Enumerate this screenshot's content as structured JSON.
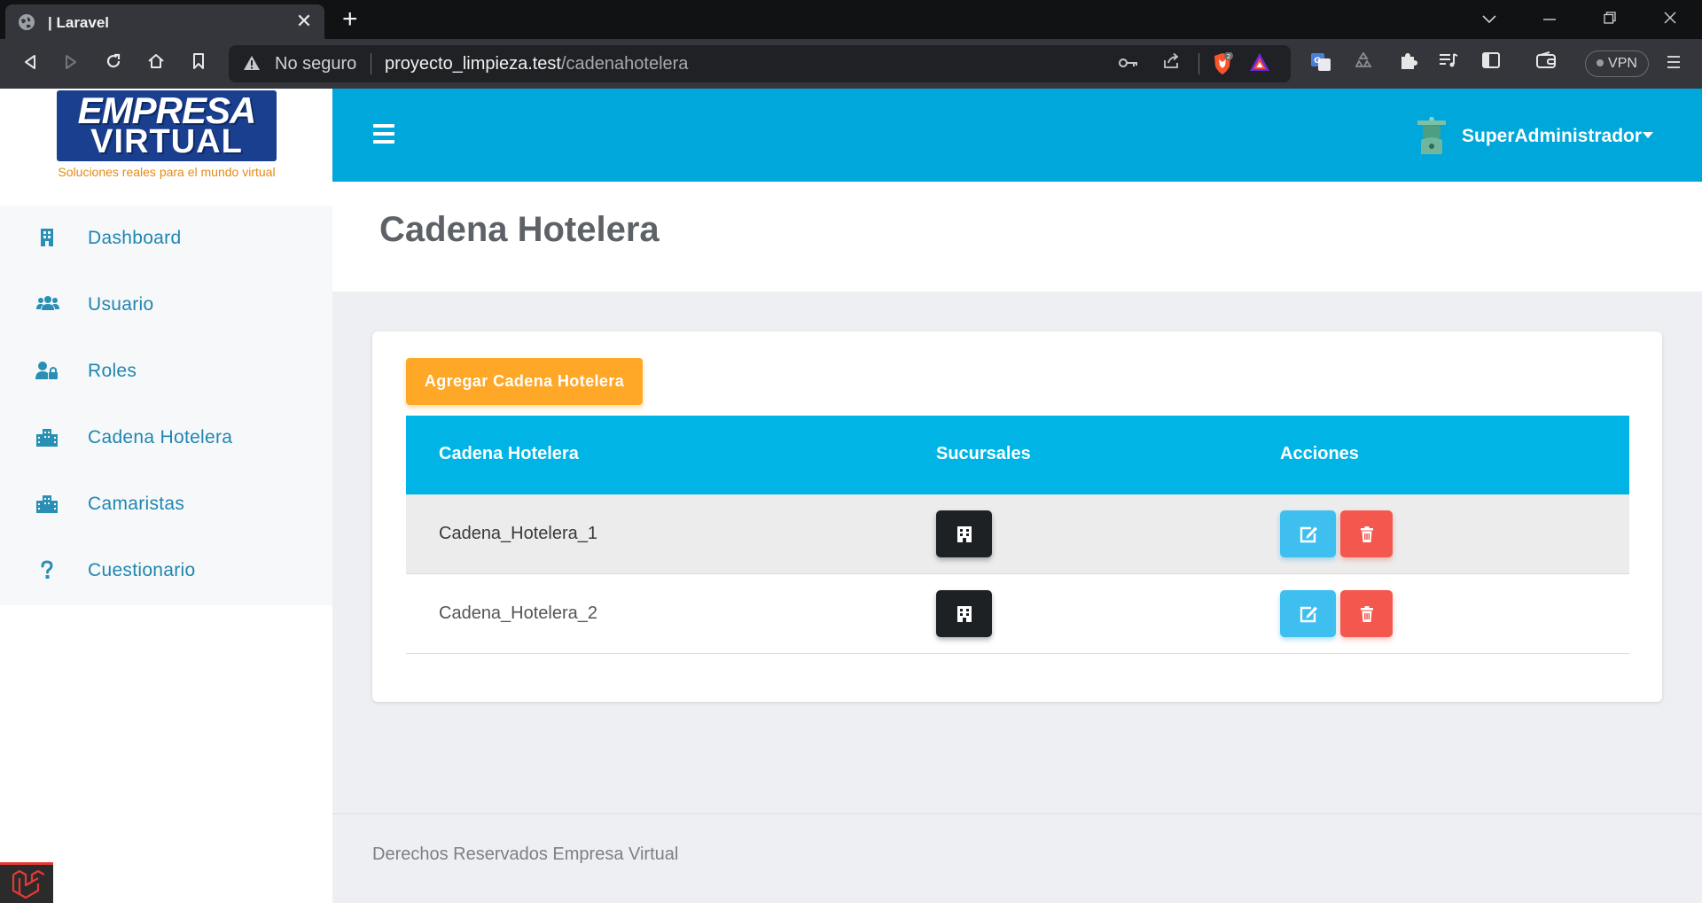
{
  "browser": {
    "tab_title": "| Laravel",
    "tab_close": "✕",
    "new_tab": "+",
    "security_label": "No seguro",
    "url_host": "proyecto_limpieza.test",
    "url_path": "/cadenahotelera",
    "brave_badge_count": "2",
    "vpn_label": "VPN"
  },
  "app": {
    "logo": {
      "line1": "EMPRESA",
      "line2": "VIRTUAL",
      "tagline": "Soluciones reales para el mundo virtual"
    },
    "sidebar": {
      "items": [
        {
          "label": "Dashboard",
          "icon": "building-icon"
        },
        {
          "label": "Usuario",
          "icon": "users-icon"
        },
        {
          "label": "Roles",
          "icon": "user-lock-icon"
        },
        {
          "label": "Cadena Hotelera",
          "icon": "city-icon"
        },
        {
          "label": "Camaristas",
          "icon": "city-icon"
        },
        {
          "label": "Cuestionario",
          "icon": "question-icon"
        }
      ]
    },
    "header": {
      "user_name": "SuperAdministrador"
    },
    "page_title": "Cadena Hotelera",
    "add_button_label": "Agregar Cadena Hotelera",
    "table": {
      "columns": [
        "Cadena Hotelera",
        "Sucursales",
        "Acciones"
      ],
      "rows": [
        {
          "name": "Cadena_Hotelera_1"
        },
        {
          "name": "Cadena_Hotelera_2"
        }
      ]
    },
    "footer_text": "Derechos Reservados Empresa Virtual"
  },
  "colors": {
    "header": "#00a7da",
    "table_header": "#00b5e6",
    "add_button": "#ffa726",
    "edit_button": "#3fbef0",
    "delete_button": "#f4574e",
    "branches_button": "#1e2124",
    "sidebar_link": "#1f86b0"
  }
}
